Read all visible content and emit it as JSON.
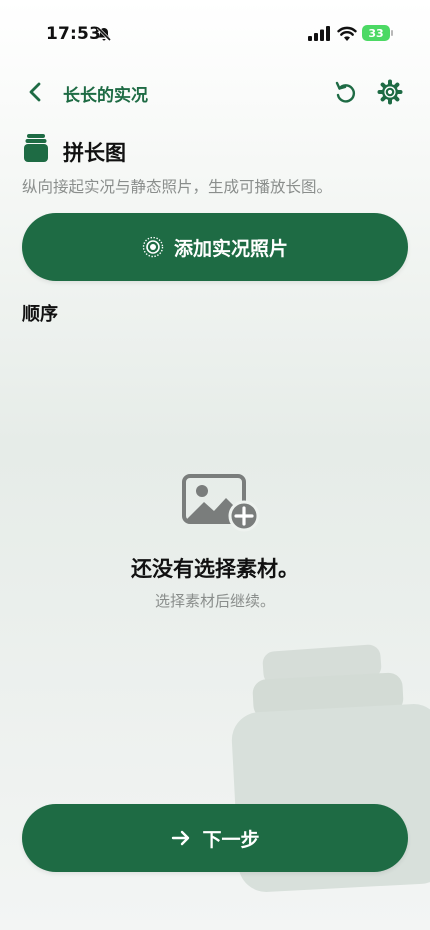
{
  "status_bar": {
    "time": "17:53",
    "battery": "33"
  },
  "nav": {
    "title": "长长的实况"
  },
  "section": {
    "title": "拼长图",
    "subtitle": "纵向接起实况与静态照片，生成可播放长图。"
  },
  "add_button": {
    "label": "添加实况照片"
  },
  "order": {
    "label": "顺序"
  },
  "empty_state": {
    "title": "还没有选择素材。",
    "subtitle": "选择素材后继续。"
  },
  "next_button": {
    "label": "下一步"
  },
  "colors": {
    "accent": "#1e6b44",
    "muted_text": "#8a8e8c",
    "battery": "#4cd964"
  }
}
